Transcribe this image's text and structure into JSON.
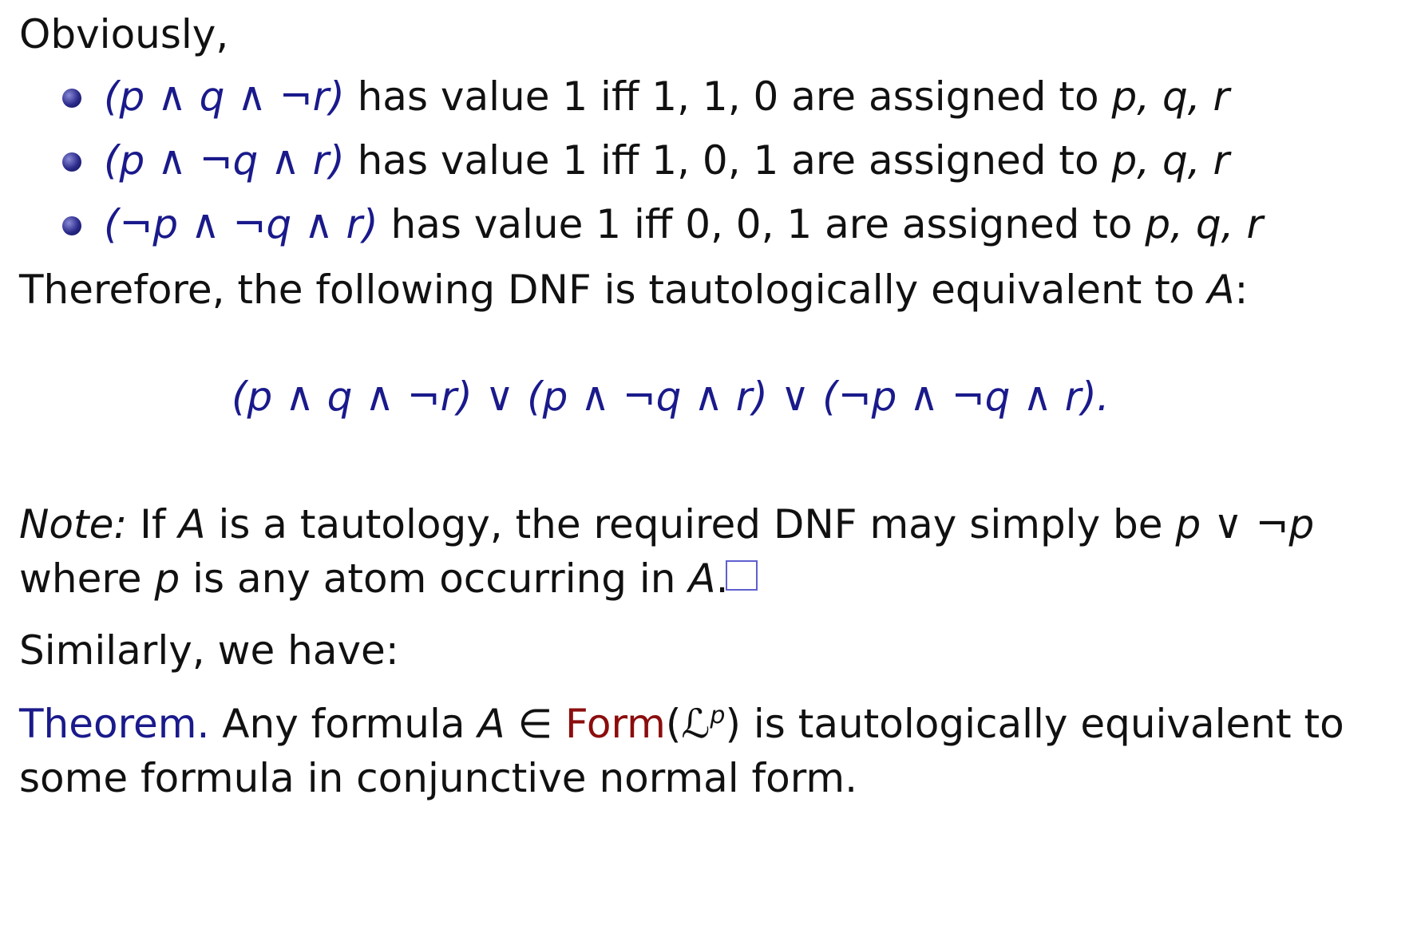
{
  "intro": "Obviously,",
  "items": [
    {
      "formula": "(p ∧ q ∧ ¬r)",
      "text_before": " has value 1 iff ",
      "values": "1, 1, 0",
      "text_after": " are assigned to ",
      "atoms": "p, q, r"
    },
    {
      "formula": "(p ∧ ¬q ∧ r)",
      "text_before": " has value 1 iff ",
      "values": "1, 0, 1",
      "text_after": " are assigned to ",
      "atoms": "p, q, r"
    },
    {
      "formula": "(¬p ∧ ¬q ∧ r)",
      "text_before": " has value 1 iff ",
      "values": "0, 0, 1",
      "text_after": " are assigned to ",
      "atoms": "p, q, r"
    }
  ],
  "therefore": {
    "text": "Therefore, the following DNF is tautologically equivalent to ",
    "var": "A",
    "colon": ":"
  },
  "dnf": "(p ∧ q ∧ ¬r) ∨ (p ∧ ¬q ∧ r) ∨ (¬p ∧ ¬q ∧ r).",
  "note": {
    "label": "Note:",
    "line1_a": " If ",
    "var_a": "A",
    "line1_b": " is a tautology, the required DNF may simply be ",
    "expr": "p ∨ ¬p",
    "line2_a": "where ",
    "var_p": "p",
    "line2_b": " is any atom occurring in ",
    "var_a2": "A",
    "line2_c": "."
  },
  "similarly": "Similarly, we have:",
  "theorem": {
    "label": "Theorem.",
    "line1_a": " Any formula ",
    "var_a": "A",
    "in": " ∈ ",
    "form": "Form",
    "lp_open": "(",
    "lp": "ℒ",
    "lp_sup": "p",
    "lp_close": ")",
    "line1_b": " is tautologically equivalent to",
    "line2": "some formula in conjunctive normal form."
  },
  "colors": {
    "blue": "#1a1a8c",
    "red": "#8b0d0d",
    "text": "#111111"
  }
}
